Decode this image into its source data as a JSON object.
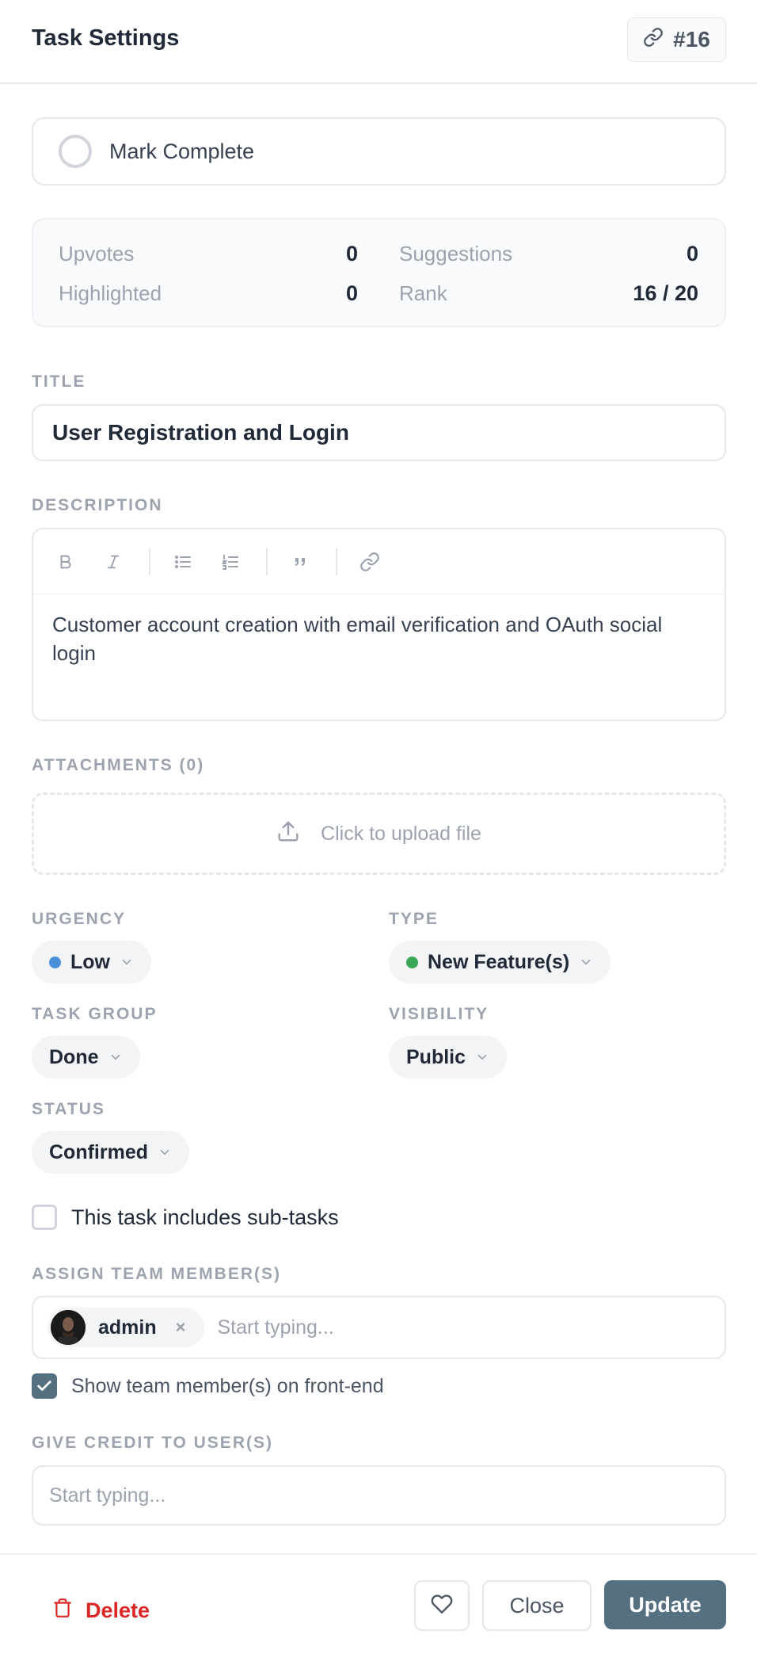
{
  "header": {
    "title": "Task Settings",
    "task_id": "#16"
  },
  "mark_complete": {
    "label": "Mark Complete",
    "checked": false
  },
  "stats": {
    "upvotes_label": "Upvotes",
    "upvotes_value": "0",
    "suggestions_label": "Suggestions",
    "suggestions_value": "0",
    "highlighted_label": "Highlighted",
    "highlighted_value": "0",
    "rank_label": "Rank",
    "rank_value": "16 / 20"
  },
  "title": {
    "label": "TITLE",
    "value": "User Registration and Login"
  },
  "description": {
    "label": "DESCRIPTION",
    "text": "Customer account creation with email verification and OAuth social login"
  },
  "attachments": {
    "label": "ATTACHMENTS (0)",
    "upload_text": "Click to upload file"
  },
  "urgency": {
    "label": "URGENCY",
    "value": "Low",
    "dot_color": "#4a90d9"
  },
  "type": {
    "label": "TYPE",
    "value": "New Feature(s)",
    "dot_color": "#3aa757"
  },
  "task_group": {
    "label": "TASK GROUP",
    "value": "Done"
  },
  "visibility": {
    "label": "VISIBILITY",
    "value": "Public"
  },
  "status": {
    "label": "STATUS",
    "value": "Confirmed"
  },
  "subtasks": {
    "label": "This task includes sub-tasks",
    "checked": false
  },
  "assign": {
    "label": "ASSIGN TEAM MEMBER(S)",
    "members": [
      "admin"
    ],
    "placeholder": "Start typing..."
  },
  "show_members": {
    "label": "Show team member(s) on front-end",
    "checked": true
  },
  "credit": {
    "label": "GIVE CREDIT TO USER(S)",
    "placeholder": "Start typing..."
  },
  "footer": {
    "delete_label": "Delete",
    "close_label": "Close",
    "update_label": "Update"
  },
  "colors": {
    "accent": "#557080",
    "danger": "#dc2626"
  }
}
